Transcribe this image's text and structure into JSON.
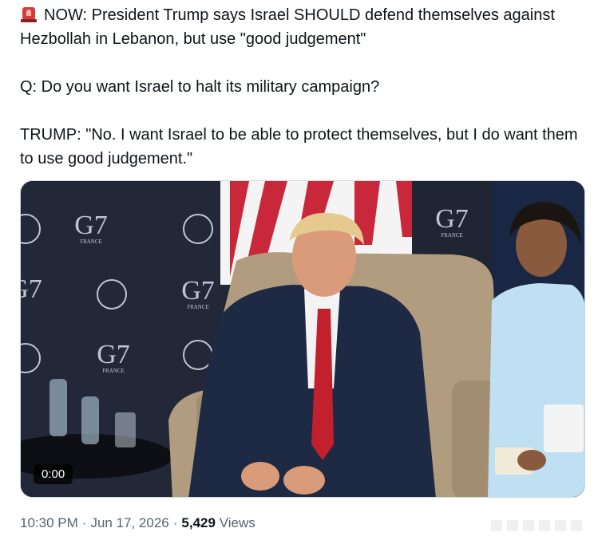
{
  "tweet": {
    "headline": "NOW: President Trump says Israel SHOULD defend themselves against Hezbollah in Lebanon, but use \"good judgement\"",
    "question": "Q: Do you want Israel to halt its military campaign?",
    "quote": "TRUMP: \"No. I want Israel to be able to protect themselves, but I do want them to use good judgement.\"",
    "icon": "rotating-light-icon"
  },
  "video": {
    "duration": "0:00",
    "backdrop_logo": "G7",
    "backdrop_country": "FRANCE"
  },
  "meta": {
    "time": "10:30 PM",
    "separator": "·",
    "date": "Jun 17, 2026",
    "views_count": "5,429",
    "views_label": "Views"
  },
  "colors": {
    "text": "#0f1419",
    "meta": "#536471",
    "siren": "#d63b3b",
    "backdrop": "#1d2330"
  }
}
